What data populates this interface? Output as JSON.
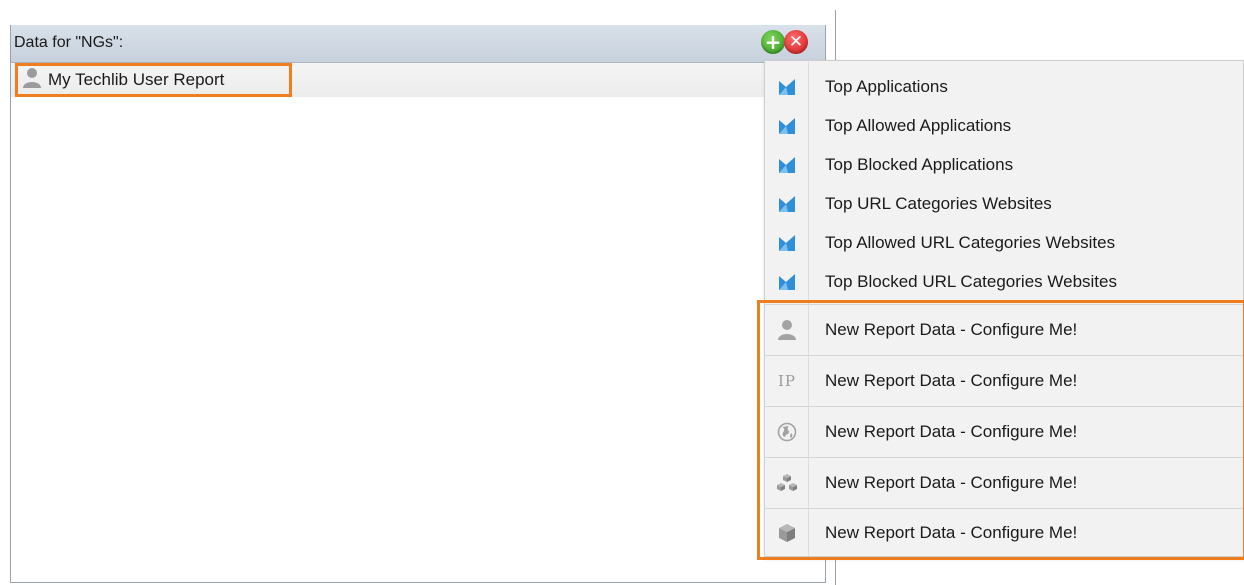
{
  "panel": {
    "title": "Data for \"NGs\":",
    "add_icon": "add-circle-icon",
    "delete_icon": "remove-circle-icon",
    "add_glyph": "+",
    "delete_glyph": "✕"
  },
  "list": {
    "selected": {
      "label": "My Techlib User Report",
      "icon": "user-icon"
    }
  },
  "menu": {
    "items": [
      {
        "label": "Top Applications",
        "icon": "report-chart-icon"
      },
      {
        "label": "Top Allowed Applications",
        "icon": "report-chart-icon"
      },
      {
        "label": "Top Blocked Applications",
        "icon": "report-chart-icon"
      },
      {
        "label": "Top URL Categories  Websites",
        "icon": "report-chart-icon"
      },
      {
        "label": "Top Allowed URL Categories  Websites",
        "icon": "report-chart-icon"
      },
      {
        "label": "Top Blocked URL Categories  Websites",
        "icon": "report-chart-icon"
      }
    ],
    "new_items": [
      {
        "label": "New Report Data - Configure Me!",
        "icon": "user-icon"
      },
      {
        "label": "New Report Data - Configure Me!",
        "icon": "ip-icon",
        "glyph": "IP"
      },
      {
        "label": "New Report Data - Configure Me!",
        "icon": "globe-icon"
      },
      {
        "label": "New Report Data - Configure Me!",
        "icon": "group-boxes-icon"
      },
      {
        "label": "New Report Data - Configure Me!",
        "icon": "cube-icon"
      }
    ]
  },
  "colors": {
    "accent_highlight": "#f07d1e",
    "header_bg": "#c7d1dc",
    "menu_bg": "#f2f2f2",
    "chart_icon_blue": "#2f8fd8"
  }
}
